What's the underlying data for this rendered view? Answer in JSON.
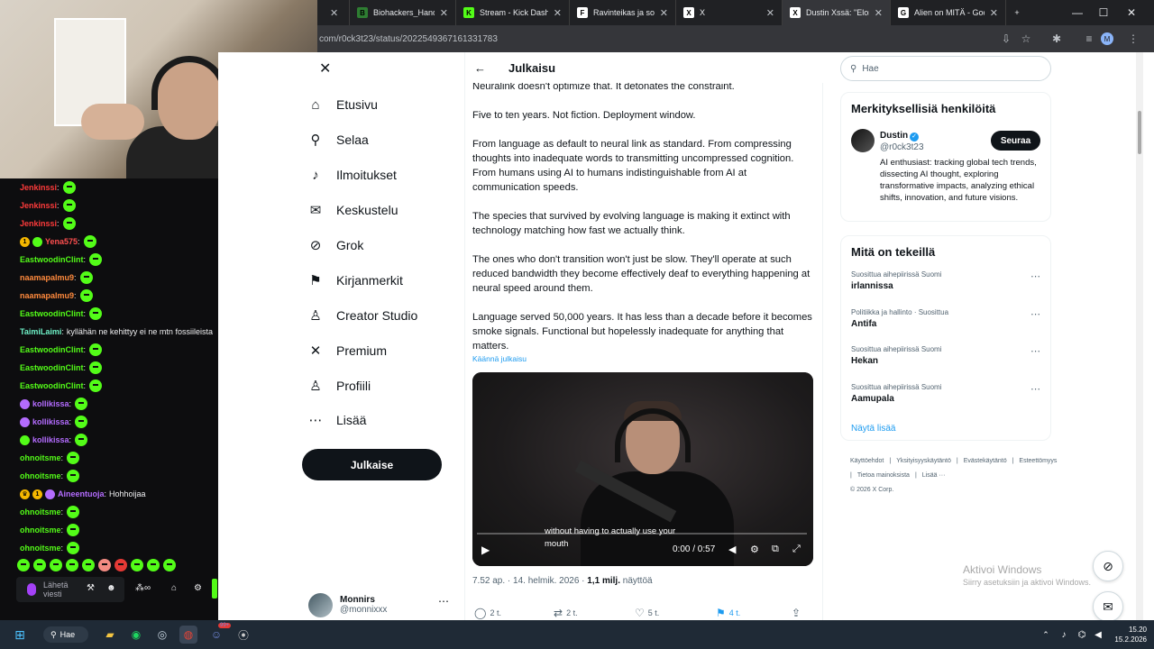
{
  "tabs": [
    {
      "label": "Biohackers_Handboo",
      "fav_color": "#2e7d32",
      "fav_glyph": "B"
    },
    {
      "label": "Stream - Kick Dashb",
      "fav_color": "#53fc18",
      "fav_glyph": "K"
    },
    {
      "label": "Ravinteikas ja sokerit",
      "fav_color": "#ffffff",
      "fav_glyph": "F"
    },
    {
      "label": "X",
      "fav_color": "#ffffff",
      "fav_glyph": "X"
    },
    {
      "label": "Dustin Xssä: \"Elon M",
      "fav_color": "#ffffff",
      "fav_glyph": "X"
    },
    {
      "label": "Alien on MITÄ - Goo",
      "fav_color": "#ffffff",
      "fav_glyph": "G"
    }
  ],
  "address": {
    "url": "com/r0ck3t23/status/2022549367161331783",
    "profile_initial": "M"
  },
  "chat": {
    "messages": [
      {
        "user": "Jenkinssi",
        "color": "#ff3b3b",
        "text": "",
        "emote": true,
        "badges": []
      },
      {
        "user": "Jenkinssi",
        "color": "#ff3b3b",
        "text": "",
        "emote": true,
        "badges": []
      },
      {
        "user": "Jenkinssi",
        "color": "#ff3b3b",
        "text": "",
        "emote": true,
        "badges": []
      },
      {
        "user": "Yena575",
        "color": "#ff4f4f",
        "text": "",
        "emote": true,
        "badges": [
          "1",
          "g"
        ]
      },
      {
        "user": "EastwoodinClint",
        "color": "#53fc18",
        "text": "",
        "emote": true,
        "badges": []
      },
      {
        "user": "naamapalmu9",
        "color": "#ff8a3d",
        "text": "",
        "emote": true,
        "badges": []
      },
      {
        "user": "naamapalmu9",
        "color": "#ff8a3d",
        "text": "",
        "emote": true,
        "badges": []
      },
      {
        "user": "EastwoodinClint",
        "color": "#53fc18",
        "text": "",
        "emote": true,
        "badges": []
      },
      {
        "user": "TaimiLaimi",
        "color": "#6ff2c8",
        "text": "kyllähän ne kehittyy ei ne mtn fossiileista",
        "emote": false,
        "badges": []
      },
      {
        "user": "EastwoodinClint",
        "color": "#53fc18",
        "text": "",
        "emote": true,
        "badges": []
      },
      {
        "user": "EastwoodinClint",
        "color": "#53fc18",
        "text": "",
        "emote": true,
        "badges": []
      },
      {
        "user": "EastwoodinClint",
        "color": "#53fc18",
        "text": "",
        "emote": true,
        "badges": []
      },
      {
        "user": "kollikissa",
        "color": "#b46cff",
        "text": "",
        "emote": true,
        "badges": [
          "p"
        ]
      },
      {
        "user": "kollikissa",
        "color": "#b46cff",
        "text": "",
        "emote": true,
        "badges": [
          "p"
        ]
      },
      {
        "user": "kollikissa",
        "color": "#b46cff",
        "text": "",
        "emote": true,
        "badges": [
          "g"
        ]
      },
      {
        "user": "ohnoitsme",
        "color": "#53fc18",
        "text": "",
        "emote": true,
        "badges": []
      },
      {
        "user": "ohnoitsme",
        "color": "#53fc18",
        "text": "",
        "emote": true,
        "badges": []
      },
      {
        "user": "Aineentuoja",
        "color": "#b46cff",
        "text": "Hohhoijaa",
        "emote": false,
        "badges": [
          "c",
          "1",
          "p"
        ]
      },
      {
        "user": "ohnoitsme",
        "color": "#53fc18",
        "text": "",
        "emote": true,
        "badges": []
      },
      {
        "user": "ohnoitsme",
        "color": "#53fc18",
        "text": "",
        "emote": true,
        "badges": []
      },
      {
        "user": "ohnoitsme",
        "color": "#53fc18",
        "text": "",
        "emote": true,
        "badges": []
      }
    ],
    "input_placeholder": "Lähetä viesti"
  },
  "nav": {
    "items": [
      {
        "label": "Etusivu",
        "icon": "home-icon",
        "glyph": "⌂"
      },
      {
        "label": "Selaa",
        "icon": "search-icon",
        "glyph": "⚲"
      },
      {
        "label": "Ilmoitukset",
        "icon": "bell-icon",
        "glyph": "♪"
      },
      {
        "label": "Keskustelu",
        "icon": "mail-icon",
        "glyph": "✉"
      },
      {
        "label": "Grok",
        "icon": "grok-icon",
        "glyph": "⊘"
      },
      {
        "label": "Kirjanmerkit",
        "icon": "bookmark-icon",
        "glyph": "⚑"
      },
      {
        "label": "Creator Studio",
        "icon": "creator-icon",
        "glyph": "♙"
      },
      {
        "label": "Premium",
        "icon": "x-logo-icon",
        "glyph": "✕"
      },
      {
        "label": "Profiili",
        "icon": "person-icon",
        "glyph": "♙"
      },
      {
        "label": "Lisää",
        "icon": "more-icon",
        "glyph": "⋯"
      }
    ],
    "post_label": "Julkaise"
  },
  "account": {
    "name": "Monnirs",
    "handle": "@monnixxx"
  },
  "post": {
    "header_title": "Julkaisu",
    "paragraphs": [
      "Neuralink doesn't optimize that. It detonates the constraint.",
      "Five to ten years. Not fiction. Deployment window.",
      "From language as default to neural link as standard. From compressing thoughts into inadequate words to transmitting uncompressed cognition. From humans using AI to humans indistinguishable from AI at communication speeds.",
      "The species that survived by evolving language is making it extinct with technology matching how fast we actually think.",
      "The ones who don't transition won't just be slow. They'll operate at such reduced bandwidth they become effectively deaf to everything happening at neural speed around them.",
      "Language served 50,000 years. It has less than a decade before it becomes smoke signals. Functional but hopelessly inadequate for anything that matters."
    ],
    "translate_label": "Käännä julkaisu",
    "video": {
      "caption_line1": "without having to actually use your",
      "caption_line2": "mouth",
      "time": "0:00 / 0:57",
      "progress": 0.0
    },
    "meta_time": "7.52 ap. · 14. helmik. 2026 · ",
    "meta_views_count": "1,1 milj.",
    "meta_views_label": " näyttöä",
    "actions": {
      "replies": "2 t.",
      "reposts": "2 t.",
      "likes": "5 t.",
      "bookmarks": "4 t."
    }
  },
  "right": {
    "search_placeholder": "Hae",
    "who_title": "Merkityksellisiä henkilöitä",
    "person": {
      "name": "Dustin",
      "handle": "@r0ck3t23",
      "bio": "AI enthusiast: tracking global tech trends, dissecting AI thought, exploring transformative impacts, analyzing ethical shifts, innovation, and future visions.",
      "follow_label": "Seuraa"
    },
    "trends_title": "Mitä on tekeillä",
    "trends": [
      {
        "context": "Suosittua aihepiirissä Suomi",
        "title": "irlannissa"
      },
      {
        "context": "Politiikka ja hallinto · Suosittua",
        "title": "Antifa"
      },
      {
        "context": "Suosittua aihepiirissä Suomi",
        "title": "Hekan"
      },
      {
        "context": "Suosittua aihepiirissä Suomi",
        "title": "Aamupala"
      }
    ],
    "show_more": "Näytä lisää",
    "footer": [
      "Käyttöehdot",
      "|",
      "Yksityisyyskäytäntö",
      "|",
      "Evästekäytäntö",
      "|",
      "Esteettömyys",
      "|",
      "Tietoa mainoksista",
      "|",
      "Lisää ···",
      "© 2026 X Corp."
    ]
  },
  "windows": {
    "activate_title": "Aktivoi Windows",
    "activate_sub": "Siirry asetuksiin ja aktivoi Windows.",
    "search": "Hae",
    "time": "15.20",
    "date": "15.2.2026",
    "badge": "99+"
  }
}
